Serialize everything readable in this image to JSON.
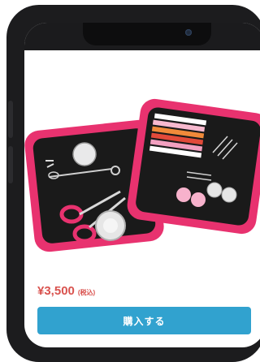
{
  "product": {
    "image_name": "pink sewing kit",
    "price": "¥3,500",
    "tax_note": "(税込)",
    "buy_label": "購入する"
  },
  "colors": {
    "accent": "#31a2cf",
    "price": "#d9534f",
    "case": "#e8326f"
  }
}
